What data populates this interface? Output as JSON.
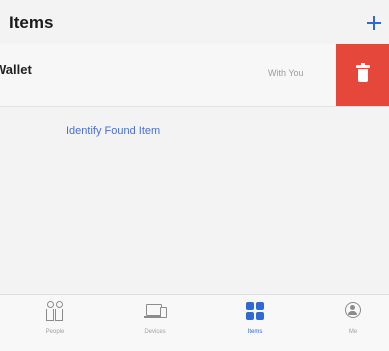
{
  "nav": {
    "title": "Items",
    "add_icon": "plus-icon"
  },
  "item": {
    "title": "Wallet",
    "status": "With You",
    "delete_icon": "trash-icon",
    "delete_color": "#e5483b"
  },
  "identify_link": "Identify Found Item",
  "tabs": [
    {
      "label": "People",
      "icon": "people-icon",
      "active": false
    },
    {
      "label": "Devices",
      "icon": "devices-icon",
      "active": false
    },
    {
      "label": "Items",
      "icon": "items-icon",
      "active": true
    },
    {
      "label": "Me",
      "icon": "me-icon",
      "active": false
    }
  ],
  "colors": {
    "accent": "#2f69d6",
    "destructive": "#e5483b"
  }
}
